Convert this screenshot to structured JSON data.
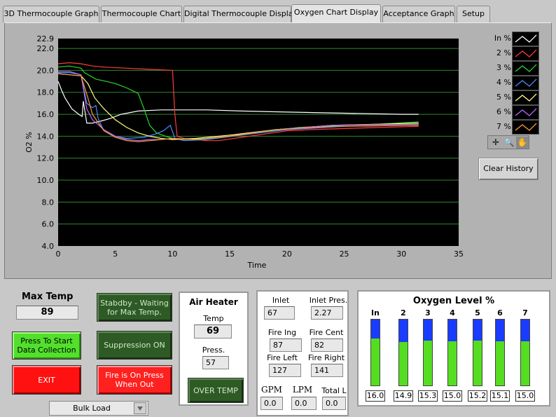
{
  "tabs": [
    {
      "label": "3D Thermocouple Graph"
    },
    {
      "label": "Thermocouple Chart"
    },
    {
      "label": "Digital Thermocouple Display"
    },
    {
      "label": "Oxygen Chart Display"
    },
    {
      "label": "Acceptance Graph"
    },
    {
      "label": "Setup"
    }
  ],
  "active_tab": "Oxygen Chart Display",
  "chart_data": {
    "type": "line",
    "xlabel": "Time",
    "ylabel": "O2 %",
    "xlim": [
      0,
      35
    ],
    "ylim": [
      4.0,
      22.9
    ],
    "xticks": [
      "0",
      "5",
      "10",
      "15",
      "20",
      "25",
      "30",
      "35"
    ],
    "yticks": [
      "4.0",
      "6.0",
      "8.0",
      "10.0",
      "12.0",
      "14.0",
      "16.0",
      "18.0",
      "20.0",
      "22.0",
      "22.9"
    ],
    "grid": true,
    "legend_position": "right",
    "series": [
      {
        "name": "In %",
        "color": "#ffffff",
        "points": [
          [
            0,
            19.0
          ],
          [
            0.3,
            18.2
          ],
          [
            0.6,
            17.5
          ],
          [
            1.2,
            16.5
          ],
          [
            1.8,
            16.0
          ],
          [
            2.1,
            15.8
          ],
          [
            2.2,
            17.2
          ],
          [
            2.5,
            15.2
          ],
          [
            3,
            15.2
          ],
          [
            3.8,
            15.4
          ],
          [
            4.5,
            15.6
          ],
          [
            5.5,
            16.0
          ],
          [
            7,
            16.3
          ],
          [
            9,
            16.4
          ],
          [
            11,
            16.4
          ],
          [
            13,
            16.4
          ],
          [
            16,
            16.3
          ],
          [
            20,
            16.2
          ],
          [
            25,
            16.1
          ],
          [
            30,
            16.0
          ],
          [
            31.5,
            16.0
          ]
        ]
      },
      {
        "name": "2 %",
        "color": "#ff3b3b",
        "points": [
          [
            0,
            20.6
          ],
          [
            1,
            20.7
          ],
          [
            2,
            20.6
          ],
          [
            3,
            20.4
          ],
          [
            4,
            20.3
          ],
          [
            6,
            20.2
          ],
          [
            8,
            20.1
          ],
          [
            10,
            20.0
          ],
          [
            10.2,
            16.0
          ],
          [
            10.4,
            14.0
          ],
          [
            11,
            13.8
          ],
          [
            12,
            13.7
          ],
          [
            13,
            13.6
          ],
          [
            14,
            13.6
          ],
          [
            16,
            13.9
          ],
          [
            18,
            14.2
          ],
          [
            20,
            14.5
          ],
          [
            22,
            14.6
          ],
          [
            25,
            14.7
          ],
          [
            28,
            14.8
          ],
          [
            31.5,
            14.9
          ]
        ]
      },
      {
        "name": "3 %",
        "color": "#2bd62b",
        "points": [
          [
            0,
            20.3
          ],
          [
            1,
            20.4
          ],
          [
            2,
            20.2
          ],
          [
            2.3,
            19.8
          ],
          [
            2.8,
            19.5
          ],
          [
            3.3,
            19.2
          ],
          [
            4.2,
            19.0
          ],
          [
            5,
            18.8
          ],
          [
            6,
            18.4
          ],
          [
            7,
            17.9
          ],
          [
            7.5,
            16.5
          ],
          [
            8,
            15.0
          ],
          [
            8.6,
            14.3
          ],
          [
            9.4,
            14.0
          ],
          [
            10,
            13.8
          ],
          [
            11,
            13.7
          ],
          [
            13,
            13.8
          ],
          [
            15,
            14.0
          ],
          [
            18,
            14.4
          ],
          [
            21,
            14.8
          ],
          [
            25,
            15.0
          ],
          [
            28,
            15.1
          ],
          [
            31.5,
            15.3
          ]
        ]
      },
      {
        "name": "4 %",
        "color": "#4a8cff",
        "points": [
          [
            0,
            19.8
          ],
          [
            1,
            19.8
          ],
          [
            2,
            19.6
          ],
          [
            2.5,
            17.0
          ],
          [
            3.0,
            16.6
          ],
          [
            3.3,
            16.8
          ],
          [
            3.5,
            15.6
          ],
          [
            4,
            14.5
          ],
          [
            5,
            14.0
          ],
          [
            6,
            13.8
          ],
          [
            7.5,
            13.9
          ],
          [
            8.5,
            14.2
          ],
          [
            9.2,
            14.5
          ],
          [
            9.8,
            15.0
          ],
          [
            10.2,
            13.8
          ],
          [
            11,
            13.6
          ],
          [
            13,
            13.7
          ],
          [
            16,
            14.1
          ],
          [
            20,
            14.6
          ],
          [
            25,
            14.9
          ],
          [
            31.5,
            15.0
          ]
        ]
      },
      {
        "name": "5 %",
        "color": "#ffff88",
        "points": [
          [
            0,
            19.7
          ],
          [
            1,
            19.6
          ],
          [
            2,
            19.5
          ],
          [
            2.6,
            18.8
          ],
          [
            3.2,
            17.5
          ],
          [
            4,
            16.5
          ],
          [
            5,
            15.5
          ],
          [
            6,
            14.8
          ],
          [
            7,
            14.3
          ],
          [
            8,
            14.0
          ],
          [
            9,
            13.8
          ],
          [
            10,
            13.7
          ],
          [
            12,
            13.8
          ],
          [
            15,
            14.1
          ],
          [
            19,
            14.6
          ],
          [
            24,
            15.0
          ],
          [
            28,
            15.1
          ],
          [
            31.5,
            15.2
          ]
        ]
      },
      {
        "name": "6 %",
        "color": "#bb66ff",
        "points": [
          [
            0,
            19.9
          ],
          [
            1,
            19.9
          ],
          [
            2,
            19.6
          ],
          [
            2.5,
            16.5
          ],
          [
            3,
            15.5
          ],
          [
            4,
            14.6
          ],
          [
            5,
            14.0
          ],
          [
            6,
            13.7
          ],
          [
            7,
            13.6
          ],
          [
            8,
            13.7
          ],
          [
            9,
            13.7
          ],
          [
            10,
            13.8
          ],
          [
            12,
            13.7
          ],
          [
            15,
            14.0
          ],
          [
            19,
            14.6
          ],
          [
            24,
            15.0
          ],
          [
            31.5,
            15.1
          ]
        ]
      },
      {
        "name": "7 %",
        "color": "#ff9a33",
        "points": [
          [
            0,
            19.7
          ],
          [
            1,
            19.6
          ],
          [
            2,
            19.5
          ],
          [
            2.6,
            17.5
          ],
          [
            3,
            16.0
          ],
          [
            4,
            14.5
          ],
          [
            5,
            13.9
          ],
          [
            6,
            13.6
          ],
          [
            7,
            13.5
          ],
          [
            8,
            13.6
          ],
          [
            9,
            13.7
          ],
          [
            10,
            13.8
          ],
          [
            12,
            13.7
          ],
          [
            15,
            14.0
          ],
          [
            19,
            14.6
          ],
          [
            24,
            14.9
          ],
          [
            31.5,
            15.0
          ]
        ]
      }
    ]
  },
  "clear_history_label": "Clear History",
  "max_temp": {
    "label": "Max Temp",
    "value": "89"
  },
  "buttons": {
    "start": "Press To Start Data Collection",
    "exit": "EXIT",
    "standby": "Stabdby - Waiting for Max Temp.",
    "suppression": "Suppression ON",
    "fire": "Fire is On Press When Out",
    "over_temp": "OVER TEMP"
  },
  "air_heater": {
    "title": "Air Heater",
    "temp_label": "Temp",
    "temp_value": "69",
    "press_label": "Press.",
    "press_value": "57"
  },
  "readings": {
    "inlet_temp_label": "Inlet Temp",
    "inlet_temp": "67",
    "inlet_pres_label": "Inlet Pres.",
    "inlet_pres": "2.27",
    "fire_ing_label": "Fire Ing",
    "fire_ing": "87",
    "fire_cent_label": "Fire Cent",
    "fire_cent": "82",
    "fire_left_label": "Fire Left",
    "fire_left": "127",
    "fire_right_label": "Fire Right",
    "fire_right": "141",
    "gpm_label": "GPM",
    "gpm": "0.0",
    "lpm_label": "LPM",
    "lpm": "0.0",
    "total_label": "Total L",
    "total": "0.0"
  },
  "oxygen_levels": {
    "title": "Oxygen Level %",
    "max": 22.9,
    "bars": [
      {
        "label": "In",
        "value": "16.0",
        "level": 16.0
      },
      {
        "label": "2",
        "value": "14.9",
        "level": 14.9
      },
      {
        "label": "3",
        "value": "15.3",
        "level": 15.3
      },
      {
        "label": "4",
        "value": "15.0",
        "level": 15.0
      },
      {
        "label": "5",
        "value": "15.2",
        "level": 15.2
      },
      {
        "label": "6",
        "value": "15.1",
        "level": 15.1
      },
      {
        "label": "7",
        "value": "15.0",
        "level": 15.0
      }
    ]
  },
  "load_select": {
    "value": "Bulk Load"
  }
}
